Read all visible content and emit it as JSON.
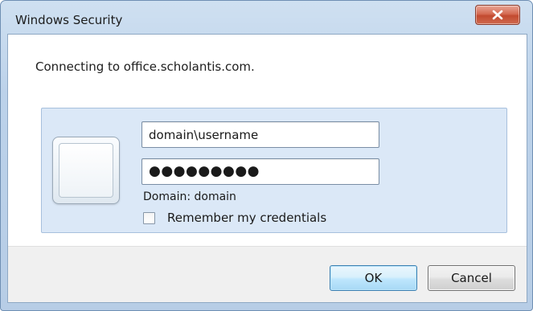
{
  "window": {
    "title": "Windows Security",
    "close_glyph": "x"
  },
  "message": {
    "connecting": "Connecting to office.scholantis.com."
  },
  "credentials": {
    "username_value": "domain\\username",
    "password_mask": "●●●●●●●●●",
    "domain_label": "Domain: domain",
    "remember_label": "Remember my credentials",
    "remember_checked": false,
    "user_tile_icon": "user-tile-icon"
  },
  "buttons": {
    "ok_label": "OK",
    "cancel_label": "Cancel"
  },
  "colors": {
    "panel_background": "#dbe8f7",
    "close_button": "#c9533a",
    "ok_button_accent": "#3c7fb1"
  }
}
